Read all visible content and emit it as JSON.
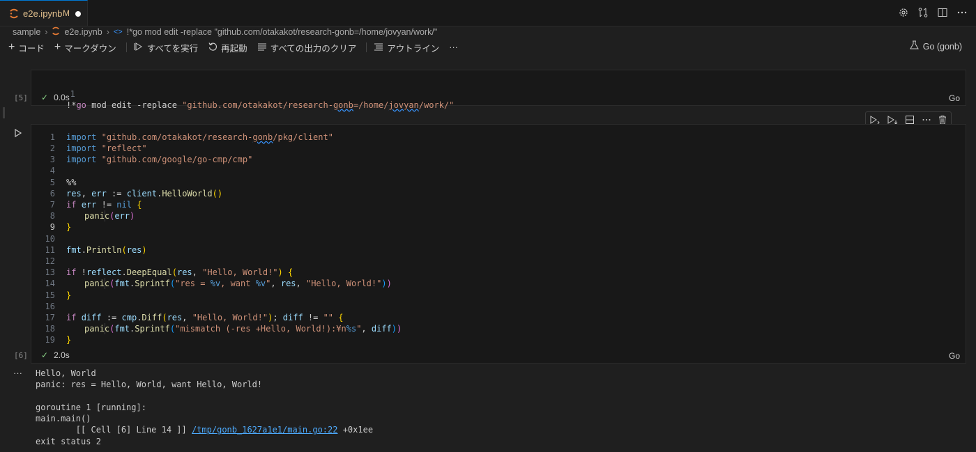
{
  "tab": {
    "filename": "e2e.ipynb",
    "modified": "M"
  },
  "breadcrumb": {
    "folder": "sample",
    "file": "e2e.ipynb",
    "cell": "!*go mod edit -replace \"github.com/otakakot/research-gonb=/home/jovyan/work/\""
  },
  "toolbar": {
    "add_code": "コード",
    "add_markdown": "マークダウン",
    "run_all": "すべてを実行",
    "restart": "再起動",
    "clear_outputs": "すべての出力のクリア",
    "outline": "アウトライン",
    "more": "···",
    "kernel": "Go (gonb)"
  },
  "cells": [
    {
      "exec_count": "[5]",
      "time": "0.0s",
      "lang": "Go"
    },
    {
      "exec_count": "[6]",
      "time": "2.0s",
      "lang": "Go"
    }
  ],
  "line_numbers": [
    "1",
    "2",
    "3",
    "4",
    "5",
    "6",
    "7",
    "8",
    "9",
    "10",
    "11",
    "12",
    "13",
    "14",
    "15",
    "16",
    "17",
    "18",
    "19"
  ],
  "code_text": {
    "c1l1a": "!*",
    "c1l1b": "go",
    "c1l1c": " mod edit -replace ",
    "c1l1d": "\"github.com/otakakot/research-",
    "c1l1e": "gonb",
    "c1l1f": "=/home/",
    "c1l1g": "jovyan",
    "c1l1h": "/work/\"",
    "import": "import",
    "imp1a": "\"github.com/otakakot/research-",
    "imp1b": "gonb",
    "imp1c": "/pkg/client\"",
    "imp2": "\"reflect\"",
    "imp3": "\"github.com/google/go-cmp/cmp\"",
    "pct": "%%",
    "res": "res",
    "err": "err",
    "assign": " := ",
    "comma": ", ",
    "client": "client",
    "dot": ".",
    "hello": "HelloWorld",
    "lp": "(",
    "rp": ")",
    "if": "if",
    "neq": " != ",
    "nil": "nil",
    "lb": "{",
    "rb": "}",
    "panic": "panic",
    "fmt": "fmt",
    "println": "Println",
    "bang": " !",
    "reflect": "reflect",
    "deepequal": "DeepEqual",
    "hw": "\"Hello, World!\"",
    "sprintf": "Sprintf",
    "fmtstr1a": "\"res = ",
    "fmtv": "%v",
    "fmtstr1b": ", want ",
    "fmtstr1c": "\"",
    "diff": "diff",
    "cmp": "cmp",
    "Diff": "Diff",
    "semi": "; ",
    "empty": "\"\"",
    "fmtstr2a": "\"mismatch (-res +Hello, World!):¥n",
    "fmts": "%s",
    "fmtstr2b": "\""
  },
  "output": {
    "ellipsis": "···",
    "lines_before": "Hello, World\npanic: res = Hello, World, want Hello, World!\n\ngoroutine 1 [running]:\nmain.main()\n        [[ Cell [6] Line 14 ]] ",
    "link": "/tmp/gonb_1627a1e1/main.go:22",
    "after_link": " +0x1ee",
    "last": "exit status 2"
  },
  "colors": {
    "accent": "#0078d4",
    "modified": "#e2c08d",
    "success": "#89d185",
    "link": "#4daafc"
  }
}
